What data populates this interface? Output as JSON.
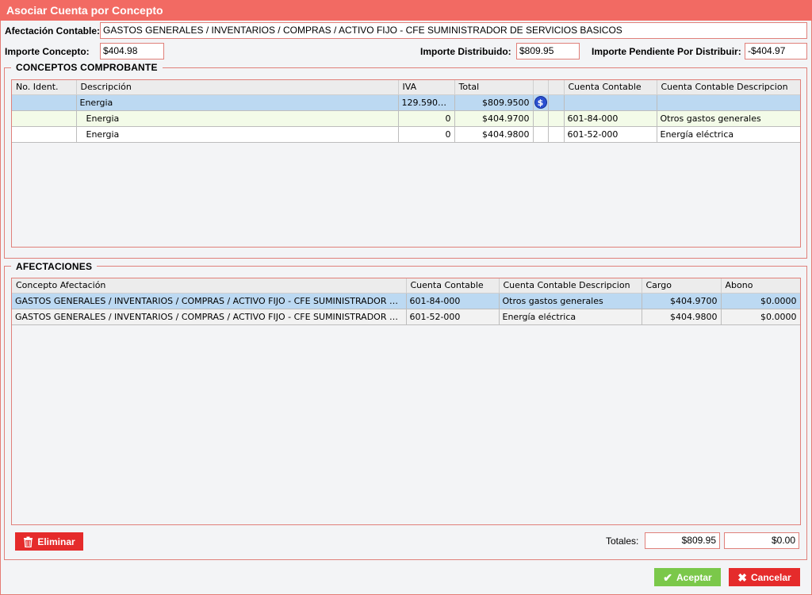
{
  "window": {
    "title": "Asociar Cuenta por Concepto"
  },
  "header": {
    "afectacion_label": "Afectación Contable:",
    "afectacion_value": "GASTOS GENERALES / INVENTARIOS / COMPRAS / ACTIVO FIJO - CFE SUMINISTRADOR DE SERVICIOS BASICOS",
    "importe_concepto_label": "Importe Concepto:",
    "importe_concepto_value": "$404.98",
    "importe_distribuido_label": "Importe Distribuido:",
    "importe_distribuido_value": "$809.95",
    "importe_pendiente_label": "Importe Pendiente Por Distribuir:",
    "importe_pendiente_value": "-$404.97"
  },
  "conceptos": {
    "title": "CONCEPTOS COMPROBANTE",
    "columns": [
      "No. Ident.",
      "Descripción",
      "IVA",
      "Total",
      "",
      "",
      "Cuenta Contable",
      "Cuenta Contable Descripcion"
    ],
    "rows": [
      {
        "no_ident": "",
        "descripcion": "Energia",
        "iva": "129.5900...",
        "total": "$809.9500",
        "icon": "info-icon",
        "extra": "",
        "cuenta": "",
        "cuenta_desc": ""
      },
      {
        "no_ident": "",
        "descripcion": "Energia",
        "iva": "0",
        "total": "$404.9700",
        "icon": "",
        "extra": "",
        "cuenta": "601-84-000",
        "cuenta_desc": "Otros gastos generales"
      },
      {
        "no_ident": "",
        "descripcion": "Energia",
        "iva": "0",
        "total": "$404.9800",
        "icon": "",
        "extra": "",
        "cuenta": "601-52-000",
        "cuenta_desc": "Energía eléctrica"
      }
    ]
  },
  "afectaciones": {
    "title": "AFECTACIONES",
    "columns": [
      "Concepto Afectación",
      "Cuenta Contable",
      "Cuenta Contable Descripcion",
      "Cargo",
      "Abono"
    ],
    "rows": [
      {
        "concepto": "GASTOS GENERALES / INVENTARIOS / COMPRAS / ACTIVO FIJO - CFE SUMINISTRADOR DE SERVICIOS BASICOS",
        "cuenta": "601-84-000",
        "cuenta_desc": "Otros gastos generales",
        "cargo": "$404.9700",
        "abono": "$0.0000"
      },
      {
        "concepto": "GASTOS GENERALES / INVENTARIOS / COMPRAS / ACTIVO FIJO - CFE SUMINISTRADOR DE SERVICIOS BASICOS",
        "cuenta": "601-52-000",
        "cuenta_desc": "Energía eléctrica",
        "cargo": "$404.9800",
        "abono": "$0.0000"
      }
    ]
  },
  "footer": {
    "eliminar_label": "Eliminar",
    "totales_label": "Totales:",
    "total_cargo": "$809.95",
    "total_abono": "$0.00",
    "aceptar_label": "Aceptar",
    "cancelar_label": "Cancelar"
  },
  "colors": {
    "accent": "#f26a63",
    "danger": "#e52b2b",
    "success": "#7bc84a",
    "selection": "#bcd9f2"
  }
}
